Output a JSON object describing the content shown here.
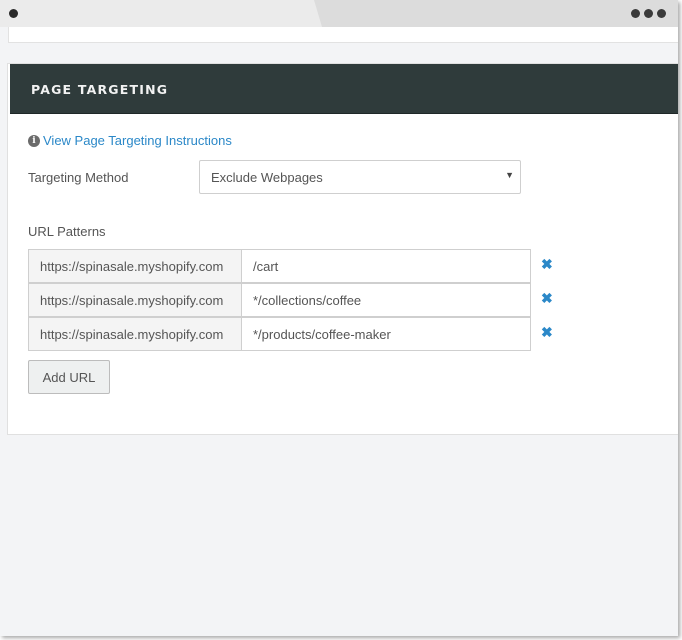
{
  "section": {
    "title": "PAGE TARGETING",
    "instructions_link": "View Page Targeting Instructions"
  },
  "targeting_method": {
    "label": "Targeting Method",
    "selected": "Exclude Webpages"
  },
  "url_patterns": {
    "label": "URL Patterns",
    "rows": [
      {
        "prefix": "https://spinasale.myshopify.com",
        "path": "/cart"
      },
      {
        "prefix": "https://spinasale.myshopify.com",
        "path": "*/collections/coffee"
      },
      {
        "prefix": "https://spinasale.myshopify.com",
        "path": "*/products/coffee-maker"
      }
    ],
    "add_label": "Add URL"
  },
  "icons": {
    "info": "info-circle-icon",
    "remove": "close-x-icon",
    "caret": "caret-down-icon"
  },
  "colors": {
    "header_bg": "#2f3b3b",
    "link": "#2b88c8"
  }
}
